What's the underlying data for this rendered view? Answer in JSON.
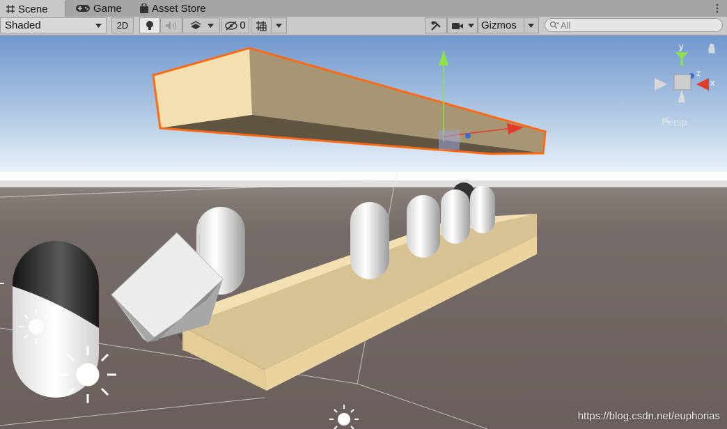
{
  "tabs": [
    {
      "label": "Scene",
      "icon": "grid-hash-icon"
    },
    {
      "label": "Game",
      "icon": "gamepad-icon"
    },
    {
      "label": "Asset Store",
      "icon": "shopping-bag-icon"
    }
  ],
  "toolbar": {
    "shading_mode": "Shaded",
    "mode_2d_label": "2D",
    "hidden_count": "0",
    "gizmos_label": "Gizmos",
    "search_placeholder": "All"
  },
  "scene_gizmo": {
    "y_label": "y",
    "z_label": "z",
    "x_label": "x",
    "projection_label": "Persp"
  },
  "watermark": "https://blog.csdn.net/euphorias",
  "colors": {
    "selection_outline": "#ff6a13",
    "gizmo_y": "#8ee047",
    "gizmo_x": "#e53a2a",
    "gizmo_z": "#3c6bd8",
    "ground": "#6f6461",
    "plank": "#f1ddb0"
  }
}
